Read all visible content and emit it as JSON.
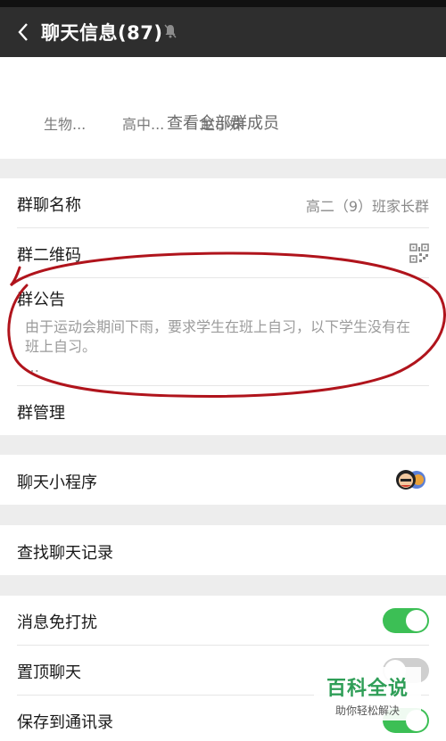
{
  "header": {
    "title": "聊天信息(87)",
    "back_icon": "chevron-left-icon",
    "mute_icon": "bell-muted-icon"
  },
  "members": {
    "names": [
      "生物...",
      "高中...",
      "赵小妹"
    ],
    "view_all": "查看全部群成员"
  },
  "group": {
    "name_label": "群聊名称",
    "name_value": "高二（9）班家长群",
    "qr_label": "群二维码",
    "notice_label": "群公告",
    "notice_text": "由于运动会期间下雨，要求学生在班上自习，以下学生没有在班上自习。",
    "notice_more": "…",
    "manage_label": "群管理"
  },
  "mini_programs": {
    "label": "聊天小程序"
  },
  "search_history": {
    "label": "查找聊天记录"
  },
  "settings": {
    "mute_label": "消息免打扰",
    "mute_on": true,
    "pin_label": "置顶聊天",
    "pin_on": false,
    "save_label": "保存到通讯录",
    "save_on": true
  },
  "watermark": {
    "brand": "百科全说",
    "slogan": "助你轻松解决"
  },
  "colors": {
    "header_bg": "#2e2e2e",
    "toggle_on": "#3cbf55",
    "annotation_red": "#b0141c"
  }
}
